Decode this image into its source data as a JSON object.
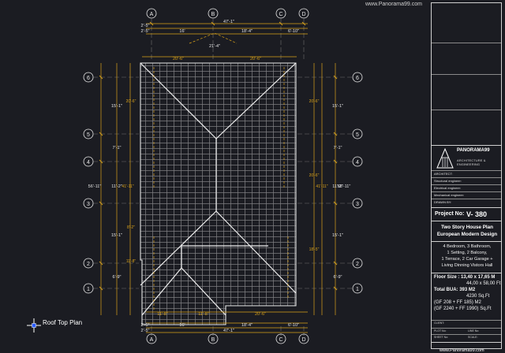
{
  "header": {
    "url": "www.Panorama99.com"
  },
  "plan": {
    "title": "Roof Top Plan",
    "grid_columns": [
      "A",
      "B",
      "C",
      "D"
    ],
    "grid_rows": [
      "6",
      "5",
      "4",
      "3",
      "2",
      "1"
    ],
    "top_dims": {
      "overall": "47'-1\"",
      "row2": [
        "2'-5\"",
        "18'",
        "18'-4\"",
        "8'-10\""
      ],
      "row1": [
        "2'-5\"",
        "16'",
        "18'-4\"",
        "6'-10\""
      ],
      "gable": "21'-4\"",
      "roof_pair": [
        "20'-6\"",
        "20'-6\""
      ]
    },
    "bottom_dims": {
      "overall": "47'-1\"",
      "row1": [
        "2'-5\"",
        "16'",
        "18'-4\"",
        "6'-10\""
      ],
      "row2": [
        "2'-5\"",
        "18'",
        "18'-4\"",
        "8'-10\""
      ],
      "roof_row": [
        "11'-8\"",
        "11'-8\"",
        "20'-6\""
      ]
    },
    "left_dims": {
      "overall": "56'-11\"",
      "segments": [
        "15'-1\"",
        "7'-1\"",
        "11'-2\"",
        "15'-1\"",
        "6'-9\""
      ],
      "inner": [
        "20'-6\"",
        "41'-11\"",
        "8'-2\"",
        "11'-8\""
      ]
    },
    "right_dims": {
      "overall": "56'-11\"",
      "segments": [
        "15'-1\"",
        "7'-1\"",
        "11'-2\"",
        "15'-1\"",
        "6'-9\""
      ],
      "inner": [
        "20'-6\"",
        "41'-11\"",
        "20'-6\"",
        "18'-5\""
      ]
    },
    "colors": {
      "background": "#1b1c22",
      "line": "#e6e6e6",
      "dimension": "#d9a21a"
    }
  },
  "title_block": {
    "logo_name": "PANORAMA99",
    "logo_sub": "ARCHITECTURE & ENGINEERING",
    "fields": [
      "ARCHITECT:",
      "Structural engineer:",
      "Electrical engineer:",
      "Mechanical engineer:",
      "DRAWN BY:"
    ],
    "project_no_label": "Project No:",
    "project_no": "V- 380",
    "title_lines": [
      "Two Story House Plan",
      "European Modern Design"
    ],
    "spec_lines": [
      "4 Bedroom, 3 Bathroom,",
      "1 Setting, 2 Balcony,",
      "1 Terrace, 2 Car Garage +",
      "Living Dinning Vistors Hall"
    ],
    "area_lines": [
      "Floor Size : 13,40 x 17,65 M",
      "44,00 x 58,00 Ft",
      "Total BUA:    393   M2",
      "4230 Sq.Ft",
      "(GF 208   + FF 185)   M2",
      "(GF 2240 + FF 1990) Sq.Ft"
    ],
    "footer_labels": [
      "CLIENT:",
      "PLOT No:",
      "SHEET No:",
      "LINE No:",
      "SCALE:"
    ],
    "footer_url": "www.Panorama99.com"
  }
}
